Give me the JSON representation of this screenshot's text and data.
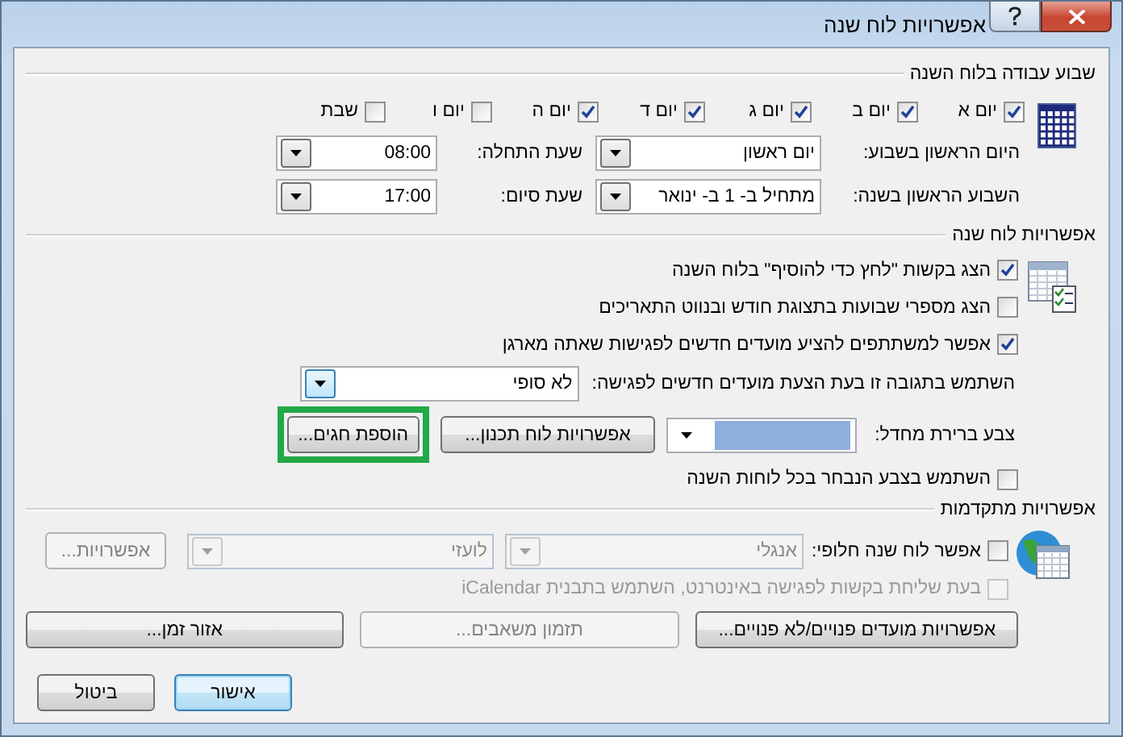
{
  "window": {
    "title": "אפשרויות לוח שנה"
  },
  "work_week": {
    "title": "שבוע עבודה בלוח השנה",
    "days": [
      {
        "label": "יום א",
        "checked": true
      },
      {
        "label": "יום ב",
        "checked": true
      },
      {
        "label": "יום ג",
        "checked": true
      },
      {
        "label": "יום ד",
        "checked": true
      },
      {
        "label": "יום ה",
        "checked": true
      },
      {
        "label": "יום ו",
        "checked": false
      },
      {
        "label": "שבת",
        "checked": false
      }
    ],
    "first_day": {
      "label": "היום הראשון בשבוע:",
      "value": "יום ראשון"
    },
    "start_time": {
      "label": "שעת התחלה:",
      "value": "08:00"
    },
    "first_week": {
      "label": "השבוע הראשון בשנה:",
      "value": "מתחיל ב- 1 ב- ינואר"
    },
    "end_time": {
      "label": "שעת סיום:",
      "value": "17:00"
    }
  },
  "calendar_options": {
    "title": "אפשרויות לוח שנה",
    "checkboxes": [
      {
        "label": "הצג בקשות \"לחץ כדי להוסיף\" בלוח השנה",
        "checked": true
      },
      {
        "label": "הצג מספרי שבועות בתצוגת חודש ובנווט התאריכים",
        "checked": false
      },
      {
        "label": "אפשר למשתתפים להציע מועדים חדשים לפגישות שאתה מארגן",
        "checked": true
      }
    ],
    "response": {
      "label": "השתמש בתגובה זו בעת הצעת מועדים חדשים לפגישה:",
      "value": "לא סופי"
    },
    "default_color": {
      "label": "צבע ברירת מחדל:",
      "color": "#8eaedc"
    },
    "buttons": [
      {
        "label": "אפשרויות לוח תכנון...",
        "highlighted": false
      },
      {
        "label": "הוספת חגים...",
        "highlighted": true
      }
    ],
    "use_color": {
      "label": "השתמש בצבע הנבחר בכל לוחות השנה",
      "checked": false
    }
  },
  "advanced": {
    "title": "אפשרויות מתקדמות",
    "alternate": {
      "label": "אפשר לוח שנה חלופי:",
      "checked": false,
      "language": {
        "value": "אנגלי",
        "disabled": true
      },
      "type": {
        "value": "לועזי",
        "disabled": true
      },
      "button": {
        "label": "אפשרויות...",
        "disabled": true
      }
    },
    "icalendar": {
      "label": "בעת שליחת בקשות לפגישה באינטרנט, השתמש בתבנית iCalendar",
      "checked": false,
      "disabled": true
    },
    "buttons": [
      {
        "label": "אפשרויות מועדים פנויים/לא פנויים...",
        "disabled": false
      },
      {
        "label": "תזמון משאבים...",
        "disabled": true
      },
      {
        "label": "אזור זמן...",
        "disabled": false
      }
    ]
  },
  "footer": {
    "buttons": [
      {
        "label": "אישור",
        "default": true
      },
      {
        "label": "ביטול",
        "default": false
      }
    ]
  }
}
